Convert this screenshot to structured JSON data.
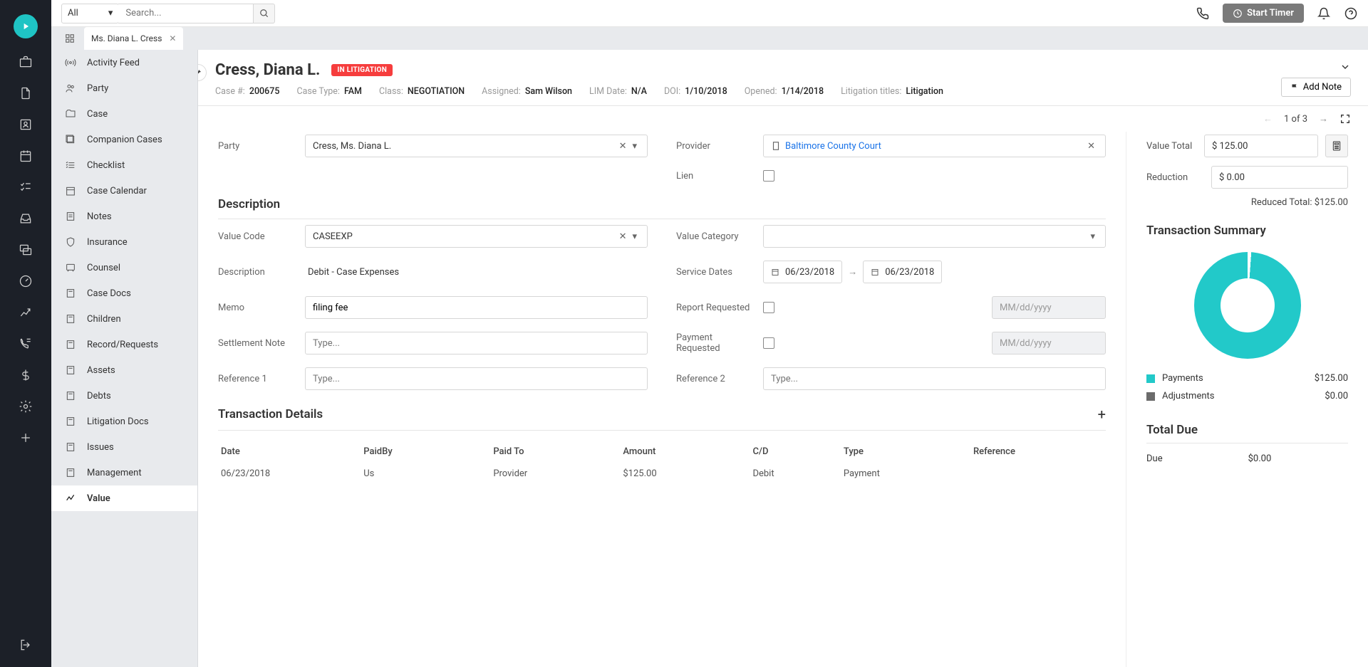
{
  "topbar": {
    "filter": "All",
    "search_placeholder": "Search...",
    "timer_label": "Start Timer"
  },
  "tab": {
    "title": "Ms. Diana L. Cress"
  },
  "sidenav": {
    "items": [
      "Activity Feed",
      "Party",
      "Case",
      "Companion Cases",
      "Checklist",
      "Case Calendar",
      "Notes",
      "Insurance",
      "Counsel",
      "Case Docs",
      "Children",
      "Record/Requests",
      "Assets",
      "Debts",
      "Litigation Docs",
      "Issues",
      "Management",
      "Value"
    ],
    "active_index": 17
  },
  "header": {
    "name": "Cress, Diana L.",
    "status": "IN LITIGATION",
    "meta": [
      {
        "label": "Case #:",
        "value": "200675"
      },
      {
        "label": "Case Type:",
        "value": "FAM"
      },
      {
        "label": "Class:",
        "value": "NEGOTIATION"
      },
      {
        "label": "Assigned:",
        "value": "Sam Wilson"
      },
      {
        "label": "LIM Date:",
        "value": "N/A"
      },
      {
        "label": "DOI:",
        "value": "1/10/2018"
      },
      {
        "label": "Opened:",
        "value": "1/14/2018"
      },
      {
        "label": "Litigation titles:",
        "value": "Litigation"
      }
    ],
    "add_note": "Add Note"
  },
  "pager": {
    "text": "1 of 3"
  },
  "form": {
    "party_label": "Party",
    "party_value": "Cress, Ms. Diana L.",
    "provider_label": "Provider",
    "provider_value": "Baltimore County Court",
    "lien_label": "Lien",
    "desc_title": "Description",
    "value_code_label": "Value Code",
    "value_code": "CASEEXP",
    "value_cat_label": "Value Category",
    "desc_label": "Description",
    "desc_value": "Debit - Case Expenses",
    "service_dates_label": "Service Dates",
    "service_from": "06/23/2018",
    "service_to": "06/23/2018",
    "memo_label": "Memo",
    "memo_value": "filing fee",
    "report_req_label": "Report Requested",
    "settlement_label": "Settlement Note",
    "type_placeholder": "Type...",
    "payment_req_label": "Payment Requested",
    "date_placeholder": "MM/dd/yyyy",
    "ref1_label": "Reference 1",
    "ref2_label": "Reference 2",
    "txn_title": "Transaction Details",
    "txn_headers": [
      "Date",
      "PaidBy",
      "Paid To",
      "Amount",
      "C/D",
      "Type",
      "Reference"
    ],
    "txn_row": [
      "06/23/2018",
      "Us",
      "Provider",
      "$125.00",
      "Debit",
      "Payment",
      ""
    ]
  },
  "summary": {
    "value_total_label": "Value Total",
    "value_total": "$ 125.00",
    "reduction_label": "Reduction",
    "reduction": "$ 0.00",
    "reduced_total": "Reduced Total: $125.00",
    "title": "Transaction Summary",
    "legend": [
      {
        "label": "Payments",
        "amount": "$125.00",
        "color": "#22c9c9"
      },
      {
        "label": "Adjustments",
        "amount": "$0.00",
        "color": "#6b6b6b"
      }
    ],
    "total_due_label": "Total Due",
    "due_label": "Due",
    "due_amount": "$0.00"
  },
  "chart_data": {
    "type": "pie",
    "title": "Transaction Summary",
    "series": [
      {
        "name": "Payments",
        "value": 125.0
      },
      {
        "name": "Adjustments",
        "value": 0.0
      }
    ],
    "colors": [
      "#22c9c9",
      "#6b6b6b"
    ]
  }
}
